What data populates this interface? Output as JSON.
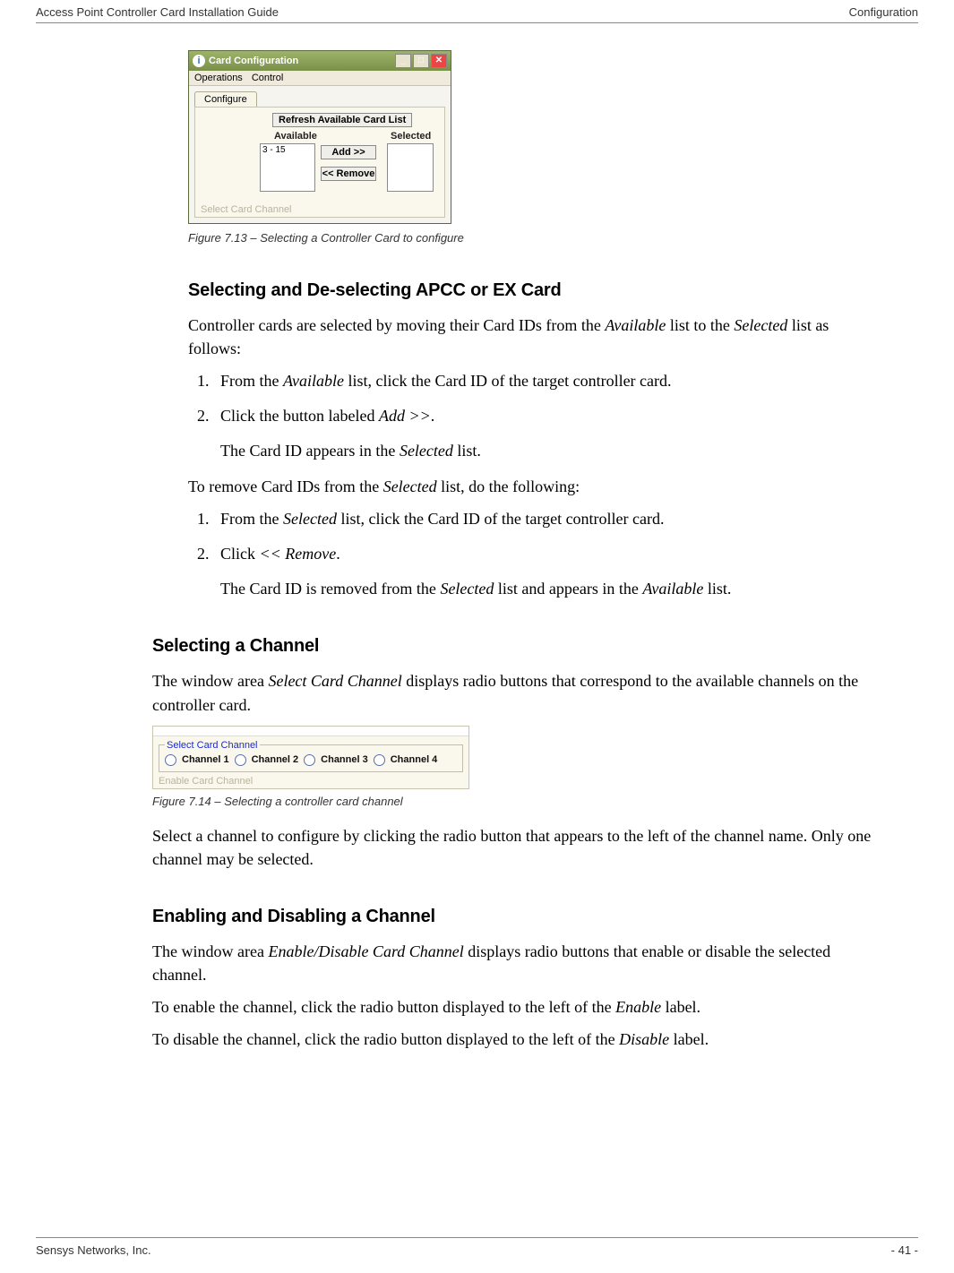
{
  "header": {
    "left": "Access Point Controller Card Installation Guide",
    "right": "Configuration"
  },
  "footer": {
    "left": "Sensys Networks, Inc.",
    "right": "- 41 -"
  },
  "fig1": {
    "window_title": "Card Configuration",
    "menu_operations": "Operations",
    "menu_control": "Control",
    "tab_configure": "Configure",
    "btn_refresh": "Refresh Available Card List",
    "lbl_available": "Available",
    "lbl_selected": "Selected",
    "available_item": "3 - 15",
    "btn_add": "Add >>",
    "btn_remove": "<< Remove",
    "fieldset_hint": "Select Card Channel",
    "caption": "Figure 7.13 – Selecting a Controller Card to configure"
  },
  "sec1": {
    "heading": "Selecting and De-selecting APCC or EX Card",
    "p1_a": "Controller cards are selected by moving their Card IDs from the ",
    "p1_i1": "Available",
    "p1_b": " list to the ",
    "p1_i2": "Selected",
    "p1_c": " list as follows:",
    "step1_a": "From the ",
    "step1_i": "Available",
    "step1_b": " list, click the Card ID of the target controller card.",
    "step2_a": "Click the button labeled ",
    "step2_i": "Add >>",
    "step2_b": ".",
    "note1_a": "The Card ID appears in the ",
    "note1_i": "Selected",
    "note1_b": " list.",
    "p2_a": "To remove Card IDs from the ",
    "p2_i": "Selected",
    "p2_b": " list, do the following:",
    "step3_a": "From the ",
    "step3_i": "Selected",
    "step3_b": " list, click the Card ID of the target controller card.",
    "step4_a": "Click ",
    "step4_i": "<< Remove",
    "step4_b": ".",
    "note2_a": "The Card ID is removed from the ",
    "note2_i1": "Selected",
    "note2_b": " list and appears in the ",
    "note2_i2": "Available",
    "note2_c": " list."
  },
  "sec2": {
    "heading": "Selecting a Channel",
    "p1_a": "The window area ",
    "p1_i": "Select Card Channel",
    "p1_b": " displays radio buttons that correspond to the available channels on the controller card."
  },
  "fig2": {
    "legend": "Select Card Channel",
    "ch1": "Channel 1",
    "ch2": "Channel 2",
    "ch3": "Channel 3",
    "ch4": "Channel 4",
    "below": "Enable Card Channel",
    "caption": "Figure 7.14 – Selecting a controller card channel"
  },
  "sec2b": {
    "p": "Select a channel to configure by clicking the radio button that appears to the left of the channel name. Only one channel may be selected."
  },
  "sec3": {
    "heading": "Enabling and Disabling a Channel",
    "p1_a": "The window area ",
    "p1_i": "Enable/Disable Card Channel",
    "p1_b": " displays radio buttons that enable or disable the selected channel.",
    "p2_a": "To enable the channel, click the radio button displayed to the left of the ",
    "p2_i": "Enable",
    "p2_b": " label.",
    "p3_a": "To disable the channel, click the radio button displayed to the left of the ",
    "p3_i": "Disable",
    "p3_b": " label."
  }
}
